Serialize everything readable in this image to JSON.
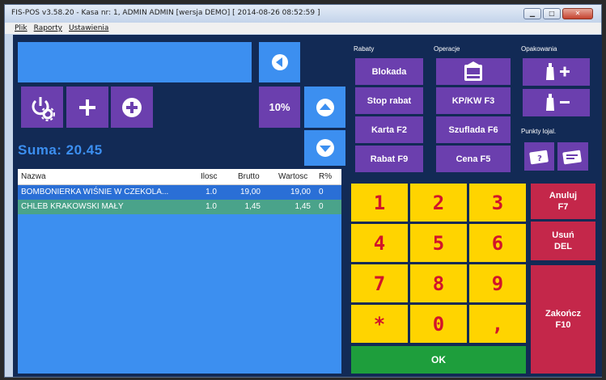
{
  "window": {
    "title": "FIS-POS v3.58.20 - Kasa nr: 1, ADMIN ADMIN [wersja DEMO]  [ 2014-08-26 08:52:59 ]"
  },
  "menu": [
    "Plik",
    "Raporty",
    "Ustawienia"
  ],
  "left": {
    "percent_label": "10%",
    "suma": "Suma: 20.45"
  },
  "table": {
    "headers": {
      "nazwa": "Nazwa",
      "ilosc": "Ilosc",
      "brutto": "Brutto",
      "wartosc": "Wartosc",
      "rabat": "R%"
    },
    "rows": [
      {
        "nazwa": "BOMBONIERKA WIŚNIE W CZEKOLA...",
        "ilosc": "1.0",
        "brutto": "19,00",
        "wartosc": "19,00",
        "rabat": "0"
      },
      {
        "nazwa": "CHLEB KRAKOWSKI MAŁY",
        "ilosc": "1.0",
        "brutto": "1,45",
        "wartosc": "1,45",
        "rabat": "0"
      }
    ]
  },
  "sections": {
    "rabaty": "Rabaty",
    "operacje": "Operacje",
    "opakowania": "Opakowania",
    "punkty": "Punkty lojal."
  },
  "rabaty": [
    "Blokada",
    "Stop rabat",
    "Karta F2",
    "Rabat F9"
  ],
  "operacje": [
    "KP/KW F3",
    "Szuflada F6",
    "Cena F5"
  ],
  "numpad": [
    "1",
    "2",
    "3",
    "4",
    "5",
    "6",
    "7",
    "8",
    "9",
    "*",
    "0",
    ","
  ],
  "side": {
    "anuluj": "Anuluj\nF7",
    "usun": "Usuń\nDEL",
    "zakoncz": "Zakończ\nF10",
    "ok": "OK"
  },
  "colors": {
    "app_bg": "#122a55",
    "blue": "#3c8ff0",
    "purple": "#6b3fae",
    "yellow": "#ffd400",
    "red_text": "#d2142a",
    "crimson": "#c4274a",
    "green": "#1e9e3c",
    "row_selected": "#2a6fd6",
    "row_alt": "#4aa38a"
  }
}
